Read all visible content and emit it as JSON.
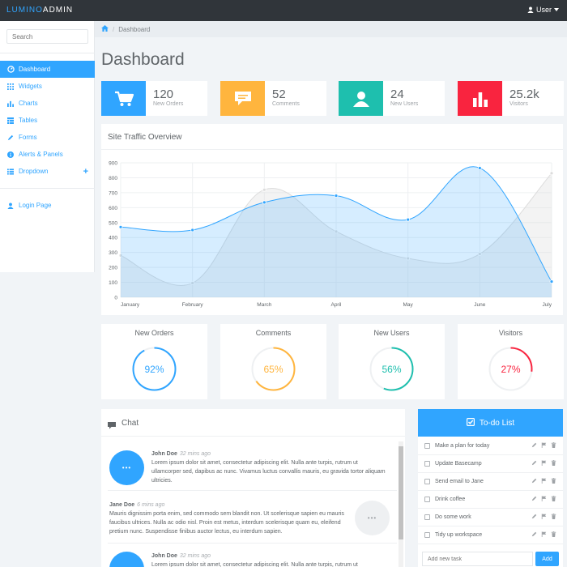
{
  "app": {
    "brand_part1": "LUMINO",
    "brand_part2": "ADMIN",
    "user_label": "User"
  },
  "colors": {
    "accent": "#30a5ff",
    "orange": "#ffb53e",
    "teal": "#1ebfae",
    "red": "#f9243f",
    "navbar": "#30353a"
  },
  "sidebar": {
    "search_placeholder": "Search",
    "items": [
      {
        "label": "Dashboard",
        "icon": "dashboard-icon",
        "active": true
      },
      {
        "label": "Widgets",
        "icon": "grid-icon"
      },
      {
        "label": "Charts",
        "icon": "bar-chart-icon"
      },
      {
        "label": "Tables",
        "icon": "table-icon"
      },
      {
        "label": "Forms",
        "icon": "pencil-icon"
      },
      {
        "label": "Alerts & Panels",
        "icon": "info-icon"
      },
      {
        "label": "Dropdown",
        "icon": "list-icon",
        "expandable_symbol": "+"
      }
    ],
    "login_label": "Login Page"
  },
  "breadcrumb": {
    "home_icon": "home-icon",
    "current": "Dashboard"
  },
  "page": {
    "title": "Dashboard"
  },
  "stats": [
    {
      "value": "120",
      "label": "New Orders",
      "icon": "cart-icon",
      "color": "#30a5ff"
    },
    {
      "value": "52",
      "label": "Comments",
      "icon": "comment-icon",
      "color": "#ffb53e"
    },
    {
      "value": "24",
      "label": "New Users",
      "icon": "user-icon",
      "color": "#1ebfae"
    },
    {
      "value": "25.2k",
      "label": "Visitors",
      "icon": "bar-chart-icon",
      "color": "#f9243f"
    }
  ],
  "traffic": {
    "title": "Site Traffic Overview"
  },
  "chart_data": {
    "type": "area",
    "title": "Site Traffic Overview",
    "categories": [
      "January",
      "February",
      "March",
      "April",
      "May",
      "June",
      "July"
    ],
    "ylim": [
      0,
      900
    ],
    "yticks": [
      "0",
      "100",
      "200",
      "300",
      "400",
      "500",
      "600",
      "700",
      "800",
      "900"
    ],
    "grid": true,
    "legend": "none",
    "series": [
      {
        "values": [
          280,
          95,
          720,
          440,
          260,
          290,
          830
        ],
        "color": "#dcdcdc",
        "filled": true
      },
      {
        "values": [
          470,
          450,
          635,
          680,
          520,
          865,
          105
        ],
        "color": "#30a5ff",
        "filled": true
      }
    ]
  },
  "circle_stats": [
    {
      "title": "New Orders",
      "percent": 92,
      "label": "92%",
      "color": "#30a5ff"
    },
    {
      "title": "Comments",
      "percent": 65,
      "label": "65%",
      "color": "#ffb53e"
    },
    {
      "title": "New Users",
      "percent": 56,
      "label": "56%",
      "color": "#1ebfae"
    },
    {
      "title": "Visitors",
      "percent": 27,
      "label": "27%",
      "color": "#f9243f"
    }
  ],
  "chat": {
    "title": "Chat",
    "messages": [
      {
        "name": "John Doe",
        "time": "32 mins ago",
        "text": "Lorem ipsum dolor sit amet, consectetur adipiscing elit. Nulla ante turpis, rutrum ut ullamcorper sed, dapibus ac nunc. Vivamus luctus convallis mauris, eu gravida tortor aliquam ultricies.",
        "avatar": "•••"
      },
      {
        "name": "Jane Doe",
        "time": "6 mins ago",
        "text": "Mauris dignissim porta enim, sed commodo sem blandit non. Ut scelerisque sapien eu mauris faucibus ultrices. Nulla ac odio nisl. Proin est metus, interdum scelerisque quam eu, eleifend pretium nunc. Suspendisse finibus auctor lectus, eu interdum sapien.",
        "avatar": "•••"
      },
      {
        "name": "John Doe",
        "time": "32 mins ago",
        "text": "Lorem ipsum dolor sit amet, consectetur adipiscing elit. Nulla ante turpis, rutrum ut",
        "avatar": "•••"
      }
    ]
  },
  "todo": {
    "title": "To-do List",
    "items": [
      "Make a plan for today",
      "Update Basecamp",
      "Send email to Jane",
      "Drink coffee",
      "Do some work",
      "Tidy up workspace"
    ],
    "new_task_placeholder": "Add new task",
    "add_label": "Add"
  }
}
